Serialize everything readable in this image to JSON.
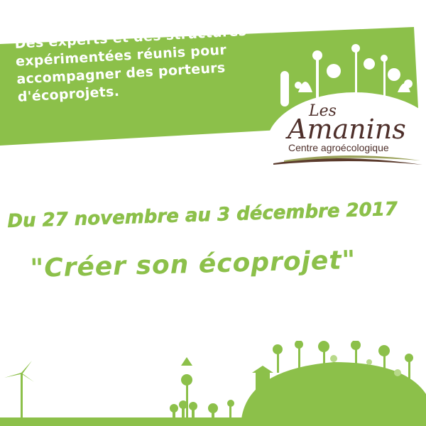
{
  "banner": {
    "lines": [
      "Des experts et des structures",
      "expérimentées réunis pour",
      "accompagner des porteurs",
      "d'écoprojets."
    ],
    "color": "#8cc04a"
  },
  "logo": {
    "les": "Les",
    "name": "Amanins",
    "subtitle": "Centre agroécologique"
  },
  "event": {
    "dates": "Du 27 novembre au 3 décembre 2017",
    "title": "\"Créer son écoprojet\""
  },
  "colors": {
    "green": "#8cc04a",
    "brown": "#4e2f2a",
    "olive": "#9aa15a",
    "lightgreen": "#b8d98a"
  }
}
